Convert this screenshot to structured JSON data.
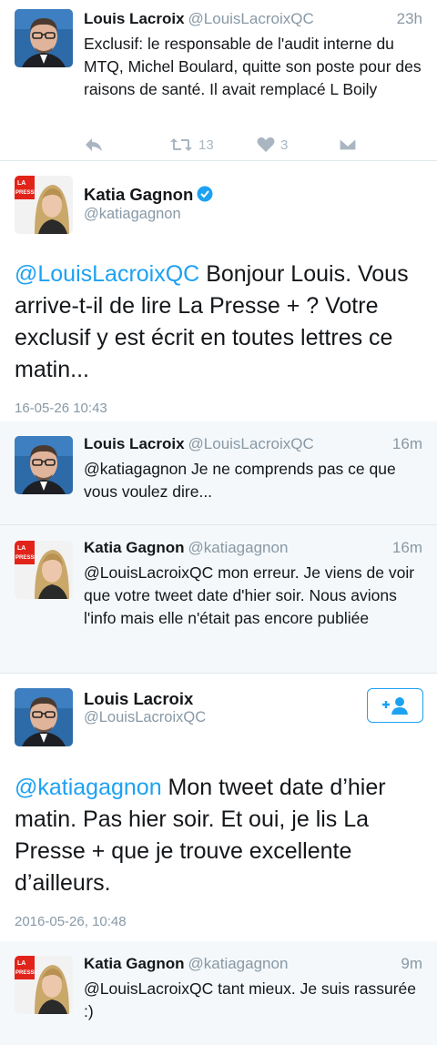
{
  "tweets": [
    {
      "name": "Louis Lacroix",
      "handle": "@LouisLacroixQC",
      "time": "23h",
      "text": "Exclusif: le responsable de l'audit interne du MTQ, Michel Boulard, quitte son poste pour des raisons de santé. Il avait remplacé L Boily",
      "retweets": "13",
      "likes": "3"
    },
    {
      "name": "Katia Gagnon",
      "handle": "@katiagagnon",
      "mention": "@LouisLacroixQC",
      "text": " Bonjour Louis. Vous arrive-t-il de lire La Presse + ? Votre exclusif y est écrit en toutes lettres ce matin...",
      "date": "16-05-26 10:43"
    },
    {
      "name": "Louis Lacroix",
      "handle": "@LouisLacroixQC",
      "time": "16m",
      "text": "@katiagagnon Je ne comprends pas ce que vous voulez dire..."
    },
    {
      "name": "Katia Gagnon",
      "handle": "@katiagagnon",
      "time": "16m",
      "text": "@LouisLacroixQC mon erreur. Je viens de voir que votre tweet date d'hier soir. Nous avions l'info mais elle n'était pas encore publiée"
    },
    {
      "name": "Louis Lacroix",
      "handle": "@LouisLacroixQC",
      "mention": "@katiagagnon",
      "text": " Mon tweet date d’hier matin. Pas hier soir. Et oui, je lis La Presse + que je trouve excellente d’ailleurs.",
      "date": "2016-05-26, 10:48"
    },
    {
      "name": "Katia Gagnon",
      "handle": "@katiagagnon",
      "time": "9m",
      "text": "@LouisLacroixQC tant mieux. Je suis rassurée :)"
    }
  ],
  "logo": {
    "line1": "LA",
    "line2": "PRESSE"
  },
  "colors": {
    "link": "#1da1f2",
    "muted": "#8899a6",
    "laPresseRed": "#e2231a"
  }
}
